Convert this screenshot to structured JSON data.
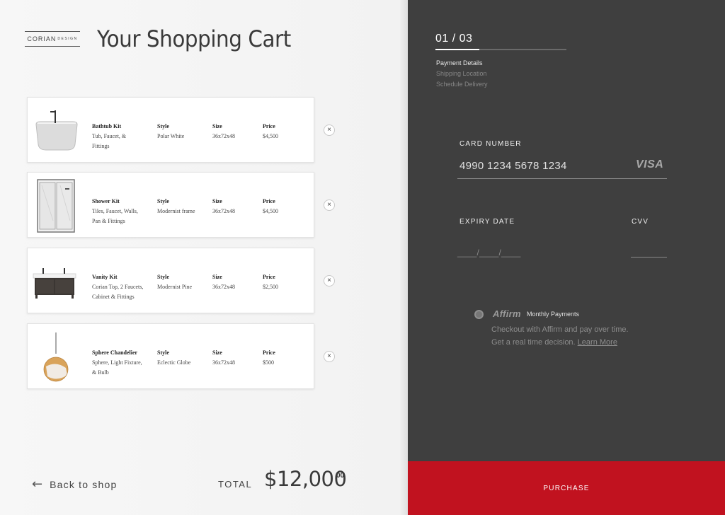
{
  "brand": {
    "logo_main": "CORIAN",
    "logo_sub": "DESIGN"
  },
  "page_title": "Your Shopping Cart",
  "cart": {
    "items": [
      {
        "name": "Bathtub Kit",
        "desc_line1": "Tub, Faucet, &",
        "desc_line2": "Fittings",
        "style_label": "Style",
        "style": "Polar White",
        "size_label": "Size",
        "size": "36x72x48",
        "price_label": "Price",
        "price": "$4,500",
        "thumb_icon": "bathtub-icon"
      },
      {
        "name": "Shower Kit",
        "desc_line1": "Tiles, Faucet, Walls,",
        "desc_line2": "Pan & Fittings",
        "style_label": "Style",
        "style": "Modernist frame",
        "size_label": "Size",
        "size": "36x72x48",
        "price_label": "Price",
        "price": "$4,500",
        "thumb_icon": "shower-icon"
      },
      {
        "name": "Vanity Kit",
        "desc_line1": "Corian Top, 2 Faucets,",
        "desc_line2": "Cabinet & Fittings",
        "style_label": "Style",
        "style": "Modernist Pine",
        "size_label": "Size",
        "size": "36x72x48",
        "price_label": "Price",
        "price": "$2,500",
        "thumb_icon": "vanity-icon"
      },
      {
        "name": "Sphere Chandelier",
        "desc_line1": "Sphere, Light Fixture,",
        "desc_line2": "& Bulb",
        "style_label": "Style",
        "style": "Eclectic Globe",
        "size_label": "Size",
        "size": "36x72x48",
        "price_label": "Price",
        "price": "$500",
        "thumb_icon": "chandelier-icon"
      }
    ],
    "remove_symbol": "×"
  },
  "footer": {
    "back_arrow": "←",
    "back_label": "Back to shop",
    "total_label": "TOTAL",
    "total_value": "$12,000",
    "total_cents": "00"
  },
  "checkout": {
    "step_counter": "01 / 03",
    "step_progress": 0.333,
    "steps": [
      {
        "label": "Payment Details",
        "active": true
      },
      {
        "label": "Shipping Location",
        "active": false
      },
      {
        "label": "Schedule Delivery",
        "active": false
      }
    ],
    "card_number_label": "CARD NUMBER",
    "card_number_value": "4990 1234 5678 1234",
    "card_brand": "VISA",
    "expiry_label": "EXPIRY DATE",
    "expiry_value": "____/____/____",
    "cvv_label": "CVV",
    "affirm": {
      "logo": "Affirm",
      "title": "Monthly Payments",
      "desc_line1": "Checkout with Affirm and pay over time.",
      "desc_line2_prefix": "Get a real time decision.",
      "learn_more": "Learn More"
    },
    "purchase_label": "PURCHASE"
  },
  "colors": {
    "panel_dark": "#3f3f3f",
    "accent_red": "#c1121f",
    "background_light": "#f4f4f4"
  }
}
